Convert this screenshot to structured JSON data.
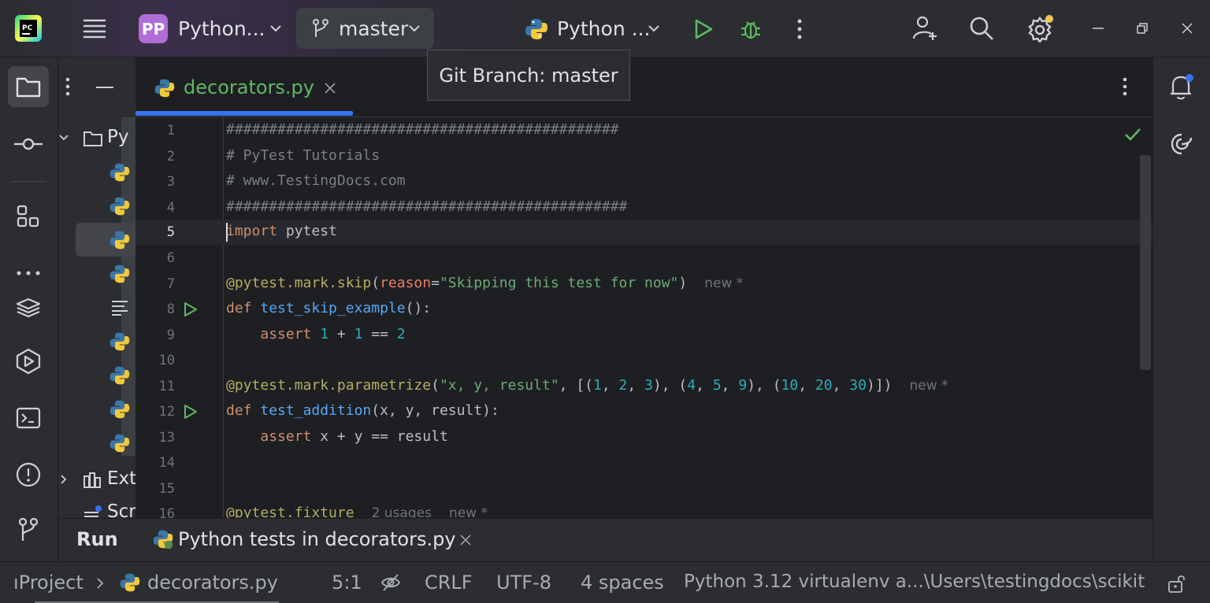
{
  "titlebar": {
    "project_badge": "PP",
    "project_name": "Python...",
    "branch": "master",
    "run_config": "Python ...",
    "icons": [
      "pycharm-logo-icon",
      "hamburger-menu-icon",
      "branch-icon",
      "python-config-icon",
      "run-icon",
      "debug-icon",
      "more-vertical-icon",
      "add-user-icon",
      "search-icon",
      "settings-icon",
      "minimize-icon",
      "restore-icon",
      "close-icon"
    ]
  },
  "tooltip": "Git Branch: master",
  "project_panel": {
    "root_label": "Py",
    "external_label": "Ext",
    "scratches_label": "Scr"
  },
  "editor": {
    "tab_label": "decorators.py",
    "line_numbers": [
      "1",
      "2",
      "3",
      "4",
      "5",
      "6",
      "7",
      "8",
      "9",
      "10",
      "11",
      "12",
      "13",
      "14",
      "15",
      "16"
    ],
    "lines": [
      "##############################################",
      "# PyTest Tutorials",
      "# www.TestingDocs.com",
      "###############################################",
      "import pytest",
      "",
      "@pytest.mark.skip(reason=\"Skipping this test for now\")",
      "def test_skip_example():",
      "    assert 1 + 1 == 2",
      "",
      "@pytest.mark.parametrize(\"x, y, result\", [(1, 2, 3), (4, 5, 9), (10, 20, 30)])",
      "def test_addition(x, y, result):",
      "    assert x + y == result",
      "",
      "",
      "@pytest.fixture"
    ],
    "hint_new": "new *",
    "hint_usages": "2 usages"
  },
  "run_bar": {
    "title": "Run",
    "tab_label": "Python tests in decorators.py"
  },
  "status_bar": {
    "project_crumb": "ıProject",
    "file_crumb": "decorators.py",
    "position": "5:1",
    "line_ending": "CRLF",
    "encoding": "UTF-8",
    "indent": "4 spaces",
    "interpreter": "Python 3.12 virtualenv a...\\Users\\testingdocs\\scikit"
  },
  "colors": {
    "accent": "#3574f0",
    "run_green": "#5fb865",
    "badge": "#b06dd6",
    "notification_dot": "#f2c55c"
  }
}
